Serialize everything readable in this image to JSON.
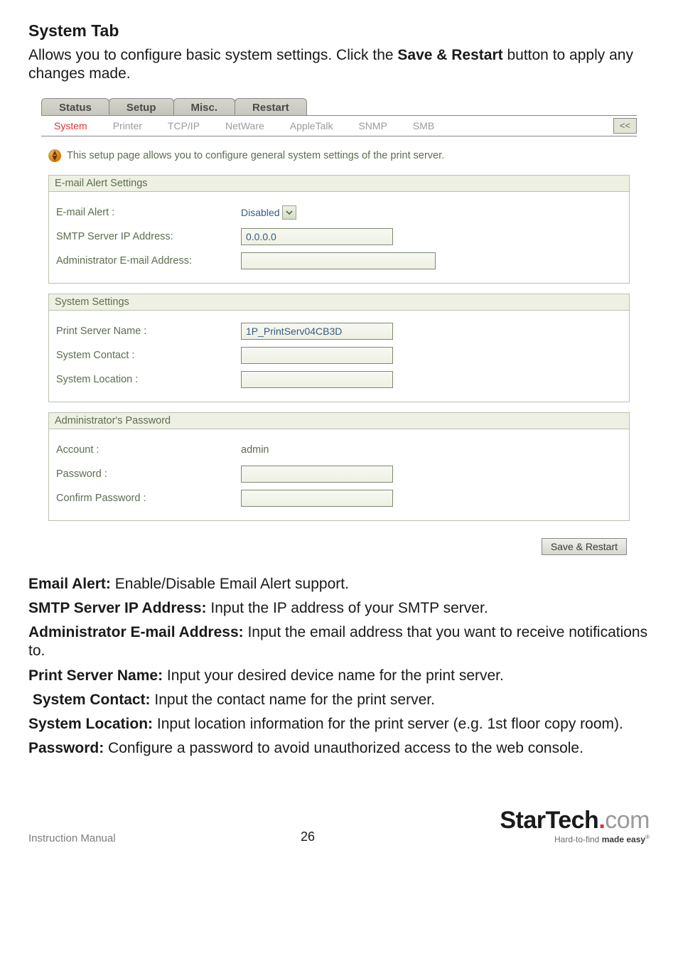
{
  "doc": {
    "section_title": "System Tab",
    "intro_pre": "Allows you to configure basic system settings. Click the ",
    "intro_bold": "Save & Restart",
    "intro_post": " button to apply any changes made.",
    "defs": {
      "email_alert_label": "Email Alert:",
      "email_alert_text": " Enable/Disable Email Alert support.",
      "smtp_label": "SMTP Server IP Address:",
      "smtp_text": " Input the IP address of your SMTP server.",
      "admin_email_label": "Administrator E-mail Address:",
      "admin_email_text": " Input the email address that you want to receive notifications to.",
      "psn_label": "Print Server Name:",
      "psn_text": " Input your desired device name for the print server.",
      "syscontact_label": "System Contact:",
      "syscontact_text": " Input the contact name for the print server.",
      "sysloc_label": "System Location:",
      "sysloc_text": " Input location information for the print server (e.g. 1st floor copy room).",
      "pwd_label": "Password:",
      "pwd_text": " Configure a password to avoid unauthorized access to the web console."
    },
    "footer_left": "Instruction Manual",
    "page_number": "26",
    "logo_main": "StarTech",
    "logo_com": "com",
    "tagline_pre": "Hard-to-find ",
    "tagline_bold": "made easy"
  },
  "ui": {
    "top_tabs": {
      "status": "Status",
      "setup": "Setup",
      "misc": "Misc.",
      "restart": "Restart"
    },
    "sub_tabs": {
      "system": "System",
      "printer": "Printer",
      "tcpip": "TCP/IP",
      "netware": "NetWare",
      "appletalk": "AppleTalk",
      "snmp": "SNMP",
      "smb": "SMB",
      "collapse": "<<"
    },
    "info_text": "This setup page allows you to configure general system settings of the print server.",
    "sections": {
      "email_head": "E-mail Alert Settings",
      "email_alert_label": "E-mail Alert :",
      "email_alert_value": "Disabled",
      "smtp_label": "SMTP Server IP Address:",
      "smtp_value": "0.0.0.0",
      "admin_email_label": "Administrator E-mail Address:",
      "admin_email_value": "",
      "system_head": "System Settings",
      "psn_label": "Print Server Name :",
      "psn_value": "1P_PrintServ04CB3D",
      "syscontact_label": "System Contact :",
      "syscontact_value": "",
      "sysloc_label": "System Location :",
      "sysloc_value": "",
      "admin_pwd_head": "Administrator's Password",
      "account_label": "Account :",
      "account_value": "admin",
      "password_label": "Password :",
      "password_value": "",
      "confirm_label": "Confirm Password :",
      "confirm_value": ""
    },
    "save_button": "Save & Restart"
  }
}
